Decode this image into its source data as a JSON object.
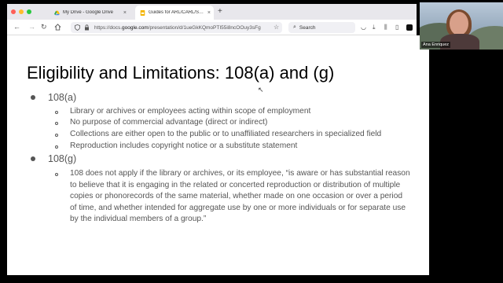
{
  "browser": {
    "tabs": [
      {
        "title": "My Drive - Google Drive",
        "icon": "google-drive-icon"
      },
      {
        "title": "Guides for ARL/CARL/SPN - Go",
        "icon": "google-slides-icon"
      }
    ],
    "url_prefix": "https://docs.",
    "url_domain": "google.com",
    "url_path": "/presentation/d/1ueGkKQmoPTI55i8ncOOuy3sFg",
    "search_placeholder": "Search",
    "new_tab": "+",
    "close_tab": "×"
  },
  "slide": {
    "title": "Eligibility and Limitations: 108(a) and (g)",
    "sections": [
      {
        "label": "108(a)",
        "items": [
          "Library or archives or employees acting within scope of employment",
          "No purpose of commercial advantage (direct or indirect)",
          "Collections are either open to the public or to unaffiliated researchers in specialized field",
          "Reproduction includes copyright notice or a substitute statement"
        ]
      },
      {
        "label": "108(g)",
        "quote": "108 does not apply if the library or archives, or its employee, “is aware or has substantial reason to believe that it is engaging in the related or concerted reproduction or distribution of multiple copies or phonorecords of the same material, whether made on one occasion or over a period of time, and whether intended for aggregate use by one or more individuals or for separate use by the individual members of a group.”"
      }
    ]
  },
  "video": {
    "participant_name": "Ana Enriquez"
  },
  "colors": {
    "traffic_red": "#fe5f57",
    "traffic_yellow": "#febc2e",
    "traffic_green": "#28c840",
    "bullet_text": "#555555"
  }
}
